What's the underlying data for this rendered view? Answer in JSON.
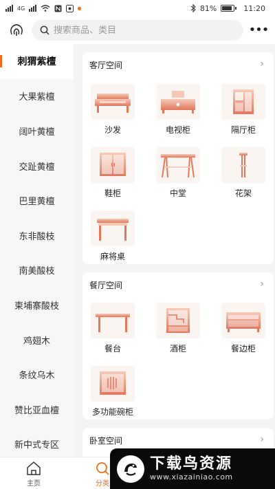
{
  "status_bar": {
    "battery": "81%",
    "time": "11:20",
    "network": "4G"
  },
  "header": {
    "search_placeholder": "搜索商品、类目",
    "more": "•••"
  },
  "sidebar": {
    "items": [
      {
        "label": "刺猬紫檀",
        "active": true
      },
      {
        "label": "大果紫檀"
      },
      {
        "label": "阔叶黄檀"
      },
      {
        "label": "交趾黄檀"
      },
      {
        "label": "巴里黄檀"
      },
      {
        "label": "东非酸枝"
      },
      {
        "label": "南美酸枝"
      },
      {
        "label": "柬埔寨酸枝"
      },
      {
        "label": "鸡翅木"
      },
      {
        "label": "条纹乌木"
      },
      {
        "label": "赞比亚血檀"
      },
      {
        "label": "新中式专区"
      }
    ]
  },
  "sections": [
    {
      "title": "客厅空间",
      "items": [
        {
          "label": "沙发",
          "icon": "sofa-icon"
        },
        {
          "label": "电视柜",
          "icon": "tv-cabinet-icon"
        },
        {
          "label": "隔厅柜",
          "icon": "partition-cabinet-icon"
        },
        {
          "label": "鞋柜",
          "icon": "shoe-cabinet-icon"
        },
        {
          "label": "中堂",
          "icon": "hall-table-icon"
        },
        {
          "label": "花架",
          "icon": "flower-stand-icon"
        },
        {
          "label": "麻将桌",
          "icon": "mahjong-table-icon"
        }
      ]
    },
    {
      "title": "餐厅空间",
      "items": [
        {
          "label": "餐台",
          "icon": "dining-table-icon"
        },
        {
          "label": "酒柜",
          "icon": "wine-cabinet-icon"
        },
        {
          "label": "餐边柜",
          "icon": "sideboard-icon"
        },
        {
          "label": "多功能碗柜",
          "icon": "bowl-cabinet-icon"
        }
      ]
    },
    {
      "title": "卧室空间",
      "items": []
    }
  ],
  "bottom_nav": [
    {
      "label": "主页",
      "icon": "home-icon"
    },
    {
      "label": "分类",
      "icon": "category-search-icon",
      "active": true
    }
  ],
  "watermark": {
    "title": "下载鸟资源",
    "url": "www.xiazainiao.com"
  },
  "colors": {
    "accent": "#f26a1b",
    "icon_light": "#f4c9b5",
    "icon_dark": "#e2775c"
  }
}
